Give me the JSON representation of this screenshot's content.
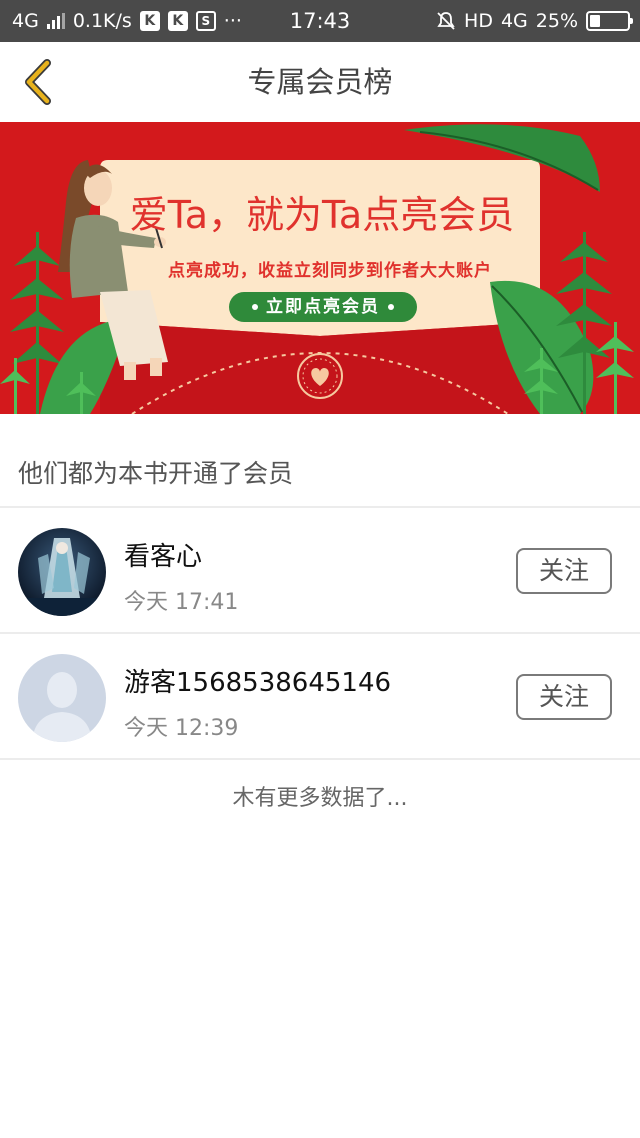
{
  "status_bar": {
    "network": "4G",
    "speed": "0.1K/s",
    "badges": [
      "K",
      "K",
      "S"
    ],
    "more": "···",
    "time": "17:43",
    "hd": "HD",
    "network_right": "4G",
    "battery": "25%",
    "battery_level": 0.25,
    "icons": [
      "signal-icon",
      "mute-alarm-icon",
      "battery-icon"
    ]
  },
  "nav": {
    "title": "专属会员榜",
    "back_icon": "chevron-left-icon",
    "accent": "#e8b21c"
  },
  "banner": {
    "title": "爱Ta，就为Ta点亮会员",
    "subtitle": "点亮成功，收益立刻同步到作者大大账户",
    "button_label": "立即点亮会员",
    "colors": {
      "background": "#d3191c",
      "card": "#fde7c9",
      "button": "#2f8a3a",
      "text": "#e0322d"
    }
  },
  "section": {
    "title": "他们都为本书开通了会员"
  },
  "members": [
    {
      "name": "看客心",
      "time": "今天 17:41",
      "follow_label": "关注",
      "avatar": "anime-avatar"
    },
    {
      "name": "游客1568538645146",
      "time": "今天 12:39",
      "follow_label": "关注",
      "avatar": "default-avatar"
    }
  ],
  "footer": {
    "no_more": "木有更多数据了..."
  }
}
